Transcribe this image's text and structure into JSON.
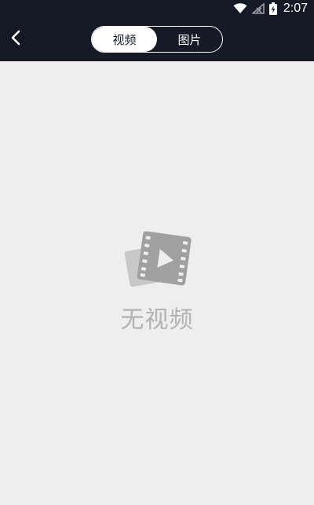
{
  "status_bar": {
    "time": "2:07",
    "icons": [
      "wifi-icon",
      "signal-off-icon",
      "battery-charging-icon"
    ]
  },
  "header": {
    "back_icon": "chevron-left-icon",
    "tabs": [
      {
        "label": "视频",
        "active": true
      },
      {
        "label": "图片",
        "active": false
      }
    ]
  },
  "empty_state": {
    "icon": "video-film-icon",
    "message": "无视频"
  },
  "colors": {
    "header_bg": "#161a26",
    "page_bg": "#eeeeee",
    "muted_icon": "#a0a0a0",
    "muted_text": "#b3b3b3"
  }
}
